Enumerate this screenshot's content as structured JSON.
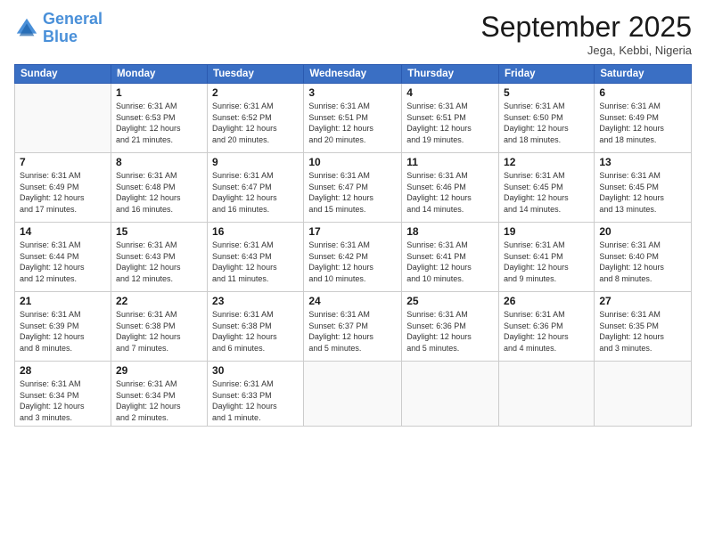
{
  "logo": {
    "line1": "General",
    "line2": "Blue"
  },
  "header": {
    "title": "September 2025",
    "location": "Jega, Kebbi, Nigeria"
  },
  "weekdays": [
    "Sunday",
    "Monday",
    "Tuesday",
    "Wednesday",
    "Thursday",
    "Friday",
    "Saturday"
  ],
  "weeks": [
    [
      {
        "day": "",
        "info": ""
      },
      {
        "day": "1",
        "info": "Sunrise: 6:31 AM\nSunset: 6:53 PM\nDaylight: 12 hours\nand 21 minutes."
      },
      {
        "day": "2",
        "info": "Sunrise: 6:31 AM\nSunset: 6:52 PM\nDaylight: 12 hours\nand 20 minutes."
      },
      {
        "day": "3",
        "info": "Sunrise: 6:31 AM\nSunset: 6:51 PM\nDaylight: 12 hours\nand 20 minutes."
      },
      {
        "day": "4",
        "info": "Sunrise: 6:31 AM\nSunset: 6:51 PM\nDaylight: 12 hours\nand 19 minutes."
      },
      {
        "day": "5",
        "info": "Sunrise: 6:31 AM\nSunset: 6:50 PM\nDaylight: 12 hours\nand 18 minutes."
      },
      {
        "day": "6",
        "info": "Sunrise: 6:31 AM\nSunset: 6:49 PM\nDaylight: 12 hours\nand 18 minutes."
      }
    ],
    [
      {
        "day": "7",
        "info": "Sunrise: 6:31 AM\nSunset: 6:49 PM\nDaylight: 12 hours\nand 17 minutes."
      },
      {
        "day": "8",
        "info": "Sunrise: 6:31 AM\nSunset: 6:48 PM\nDaylight: 12 hours\nand 16 minutes."
      },
      {
        "day": "9",
        "info": "Sunrise: 6:31 AM\nSunset: 6:47 PM\nDaylight: 12 hours\nand 16 minutes."
      },
      {
        "day": "10",
        "info": "Sunrise: 6:31 AM\nSunset: 6:47 PM\nDaylight: 12 hours\nand 15 minutes."
      },
      {
        "day": "11",
        "info": "Sunrise: 6:31 AM\nSunset: 6:46 PM\nDaylight: 12 hours\nand 14 minutes."
      },
      {
        "day": "12",
        "info": "Sunrise: 6:31 AM\nSunset: 6:45 PM\nDaylight: 12 hours\nand 14 minutes."
      },
      {
        "day": "13",
        "info": "Sunrise: 6:31 AM\nSunset: 6:45 PM\nDaylight: 12 hours\nand 13 minutes."
      }
    ],
    [
      {
        "day": "14",
        "info": "Sunrise: 6:31 AM\nSunset: 6:44 PM\nDaylight: 12 hours\nand 12 minutes."
      },
      {
        "day": "15",
        "info": "Sunrise: 6:31 AM\nSunset: 6:43 PM\nDaylight: 12 hours\nand 12 minutes."
      },
      {
        "day": "16",
        "info": "Sunrise: 6:31 AM\nSunset: 6:43 PM\nDaylight: 12 hours\nand 11 minutes."
      },
      {
        "day": "17",
        "info": "Sunrise: 6:31 AM\nSunset: 6:42 PM\nDaylight: 12 hours\nand 10 minutes."
      },
      {
        "day": "18",
        "info": "Sunrise: 6:31 AM\nSunset: 6:41 PM\nDaylight: 12 hours\nand 10 minutes."
      },
      {
        "day": "19",
        "info": "Sunrise: 6:31 AM\nSunset: 6:41 PM\nDaylight: 12 hours\nand 9 minutes."
      },
      {
        "day": "20",
        "info": "Sunrise: 6:31 AM\nSunset: 6:40 PM\nDaylight: 12 hours\nand 8 minutes."
      }
    ],
    [
      {
        "day": "21",
        "info": "Sunrise: 6:31 AM\nSunset: 6:39 PM\nDaylight: 12 hours\nand 8 minutes."
      },
      {
        "day": "22",
        "info": "Sunrise: 6:31 AM\nSunset: 6:38 PM\nDaylight: 12 hours\nand 7 minutes."
      },
      {
        "day": "23",
        "info": "Sunrise: 6:31 AM\nSunset: 6:38 PM\nDaylight: 12 hours\nand 6 minutes."
      },
      {
        "day": "24",
        "info": "Sunrise: 6:31 AM\nSunset: 6:37 PM\nDaylight: 12 hours\nand 5 minutes."
      },
      {
        "day": "25",
        "info": "Sunrise: 6:31 AM\nSunset: 6:36 PM\nDaylight: 12 hours\nand 5 minutes."
      },
      {
        "day": "26",
        "info": "Sunrise: 6:31 AM\nSunset: 6:36 PM\nDaylight: 12 hours\nand 4 minutes."
      },
      {
        "day": "27",
        "info": "Sunrise: 6:31 AM\nSunset: 6:35 PM\nDaylight: 12 hours\nand 3 minutes."
      }
    ],
    [
      {
        "day": "28",
        "info": "Sunrise: 6:31 AM\nSunset: 6:34 PM\nDaylight: 12 hours\nand 3 minutes."
      },
      {
        "day": "29",
        "info": "Sunrise: 6:31 AM\nSunset: 6:34 PM\nDaylight: 12 hours\nand 2 minutes."
      },
      {
        "day": "30",
        "info": "Sunrise: 6:31 AM\nSunset: 6:33 PM\nDaylight: 12 hours\nand 1 minute."
      },
      {
        "day": "",
        "info": ""
      },
      {
        "day": "",
        "info": ""
      },
      {
        "day": "",
        "info": ""
      },
      {
        "day": "",
        "info": ""
      }
    ]
  ]
}
